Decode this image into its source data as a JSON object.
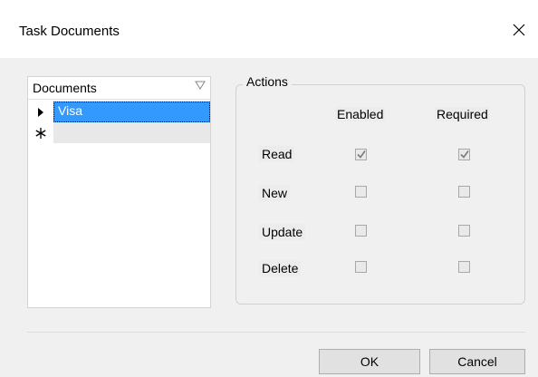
{
  "window": {
    "title": "Task Documents"
  },
  "grid": {
    "column_header": "Documents",
    "rows": [
      {
        "indicator": "current",
        "value": "Visa"
      },
      {
        "indicator": "new",
        "value": ""
      }
    ]
  },
  "actions": {
    "title": "Actions",
    "columns": [
      "Enabled",
      "Required"
    ],
    "rows": [
      {
        "label": "Read",
        "enabled": true,
        "required": true
      },
      {
        "label": "New",
        "enabled": false,
        "required": false
      },
      {
        "label": "Update",
        "enabled": false,
        "required": false
      },
      {
        "label": "Delete",
        "enabled": false,
        "required": false
      }
    ]
  },
  "buttons": {
    "ok": "OK",
    "cancel": "Cancel"
  },
  "icons": {
    "close": "close-icon",
    "filter": "filter-icon",
    "row_pointer": "row-pointer-icon",
    "new_row": "new-row-asterisk-icon",
    "check": "check-icon"
  }
}
